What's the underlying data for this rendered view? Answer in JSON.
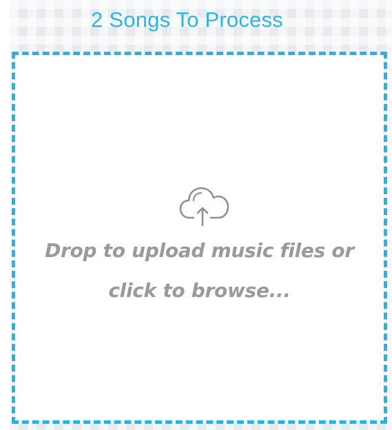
{
  "header": {
    "title": "2 Songs To Process"
  },
  "dropzone": {
    "line1": "Drop to upload music files or",
    "line2": "click to browse...",
    "icon": "cloud-upload-icon"
  },
  "colors": {
    "accent": "#29b3e4",
    "text_muted": "#9a9a9a",
    "background": "#f5f6f7"
  }
}
